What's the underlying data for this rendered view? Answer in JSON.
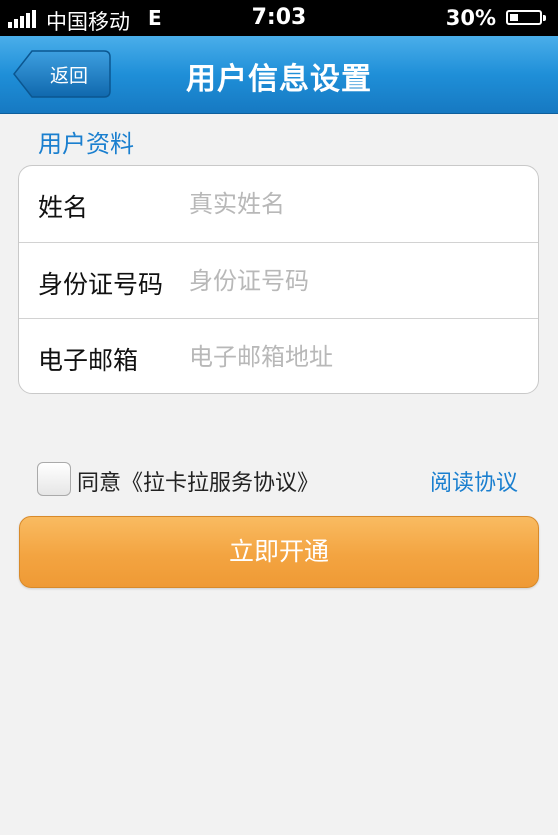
{
  "status_bar": {
    "carrier": "中国移动",
    "network": "E",
    "time": "7:03",
    "battery_percent": "30%",
    "battery_level": 0.3
  },
  "nav": {
    "back_label": "返回",
    "title": "用户信息设置",
    "bar_color": "#1f8fd8"
  },
  "profile": {
    "section_title": "用户资料",
    "fields": [
      {
        "label": "姓名",
        "placeholder": "真实姓名",
        "value": ""
      },
      {
        "label": "身份证号码",
        "placeholder": "身份证号码",
        "value": ""
      },
      {
        "label": "电子邮箱",
        "placeholder": "电子邮箱地址",
        "value": ""
      }
    ]
  },
  "agreement": {
    "checked": false,
    "text": "同意《拉卡拉服务协议》",
    "read_link": "阅读协议"
  },
  "submit": {
    "label": "立即开通",
    "color": "#f3a441"
  },
  "colors": {
    "accent": "#1a7fcf",
    "background": "#f2f2f2"
  },
  "icons": {
    "signal": "signal-bars-icon",
    "battery": "battery-icon",
    "back": "back-arrow-icon"
  }
}
